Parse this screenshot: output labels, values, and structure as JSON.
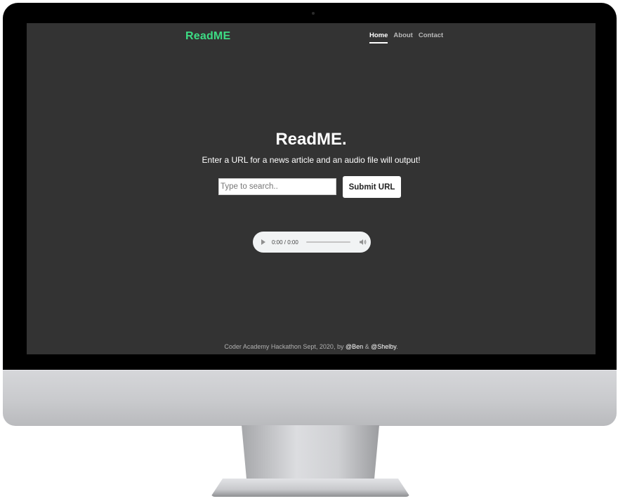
{
  "header": {
    "brand": "ReadME",
    "nav": [
      {
        "label": "Home",
        "active": true
      },
      {
        "label": "About",
        "active": false
      },
      {
        "label": "Contact",
        "active": false
      }
    ]
  },
  "hero": {
    "title": "ReadME.",
    "subtitle": "Enter a URL for a news article and an audio file will output!"
  },
  "search": {
    "placeholder": "Type to search..",
    "value": "",
    "submit_label": "Submit URL"
  },
  "audio": {
    "time": "0:00 / 0:00",
    "progress": 0
  },
  "footer": {
    "text": "Coder Academy Hackathon Sept, 2020, by ",
    "link_ben": "@Ben",
    "amp": " & ",
    "link_shelby": "@Shelby",
    "end": "."
  },
  "colors": {
    "page_background": "#333333",
    "brand_accent": "#3ddc84",
    "text_primary": "#ffffff",
    "nav_inactive": "#b8b8b8",
    "footer_text": "#b0b0b0"
  },
  "icons": {
    "play": "play-icon",
    "volume": "volume-icon"
  }
}
